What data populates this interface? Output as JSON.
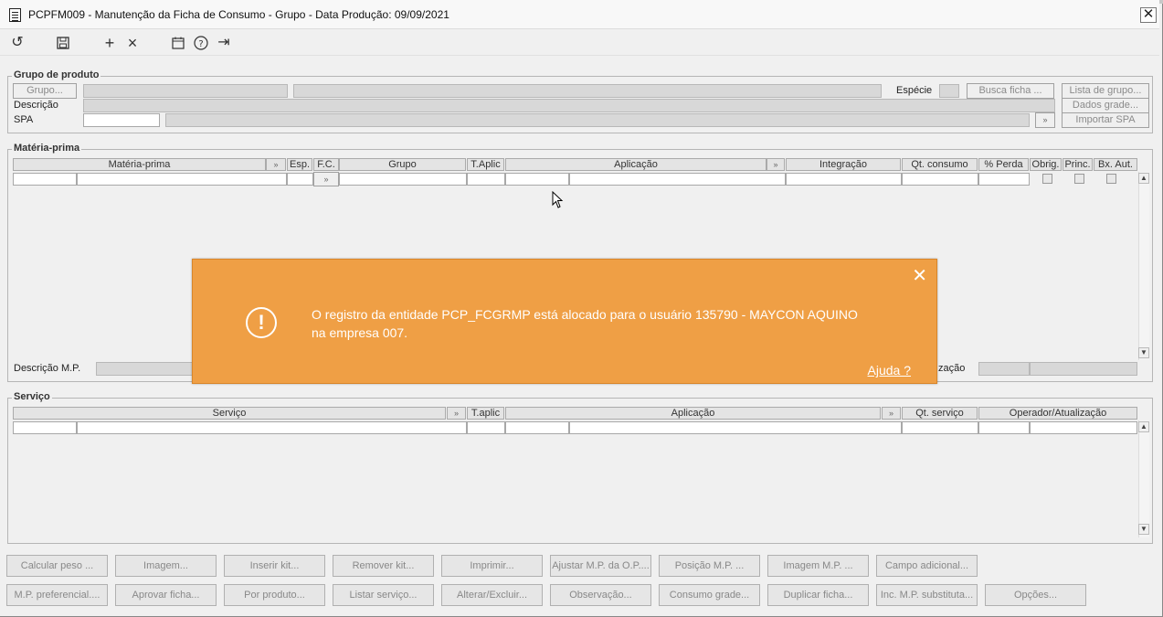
{
  "window": {
    "title": "PCPFM009 - Manutenção da Ficha de Consumo - Grupo - Data Produção: 09/09/2021",
    "close_glyph": "✕"
  },
  "toolbar": {
    "icons": [
      "refresh-icon",
      "save-icon",
      "add-icon",
      "delete-icon",
      "calendar-icon",
      "help-icon",
      "exit-icon"
    ],
    "glyphs": {
      "refresh": "↺",
      "save": "💾",
      "add": "+",
      "delete": "×",
      "calendar": "▦",
      "help": "?",
      "exit": "⇥"
    }
  },
  "grupo_produto": {
    "legend": "Grupo de produto",
    "grupo_btn": "Grupo...",
    "especie_label": "Espécie",
    "busca_ficha_btn": "Busca ficha ...",
    "lista_grupo_btn": "Lista de grupo...",
    "descricao_label": "Descrição",
    "dados_grade_btn": "Dados grade...",
    "spa_label": "SPA",
    "importar_spa_btn": "Importar SPA"
  },
  "materia_prima": {
    "legend": "Matéria-prima",
    "columns": [
      "Matéria-prima",
      "Esp.",
      "F.C.",
      "Grupo",
      "T.Aplic",
      "Aplicação",
      "Integração",
      "Qt. consumo",
      "% Perda",
      "Obrig.",
      "Princ.",
      "Bx. Aut."
    ],
    "descricao_mp_label": "Descrição M.P.",
    "operador_label": "zação"
  },
  "servico": {
    "legend": "Serviço",
    "columns": [
      "Serviço",
      "T.aplic",
      "Aplicação",
      "Qt. serviço",
      "Operador/Atualização"
    ]
  },
  "buttons_row1": [
    "Calcular peso ...",
    "Imagem...",
    "Inserir kit...",
    "Remover kit...",
    "Imprimir...",
    "Ajustar M.P. da O.P....",
    "Posição M.P. ...",
    "Imagem M.P. ...",
    "Campo adicional..."
  ],
  "buttons_row2": [
    "M.P. preferencial....",
    "Aprovar ficha...",
    "Por produto...",
    "Listar serviço...",
    "Alterar/Excluir...",
    "Observação...",
    "Consumo grade...",
    "Duplicar ficha...",
    "Inc. M.P. substituta...",
    "Opções..."
  ],
  "dialog": {
    "message": "O registro da entidade PCP_FCGRMP está alocado para o usuário 135790 - MAYCON AQUINO na empresa 007.",
    "help_link": "Ajuda ?",
    "close_glyph": "✕",
    "warning_glyph": "!",
    "color": "#ef9f45"
  }
}
